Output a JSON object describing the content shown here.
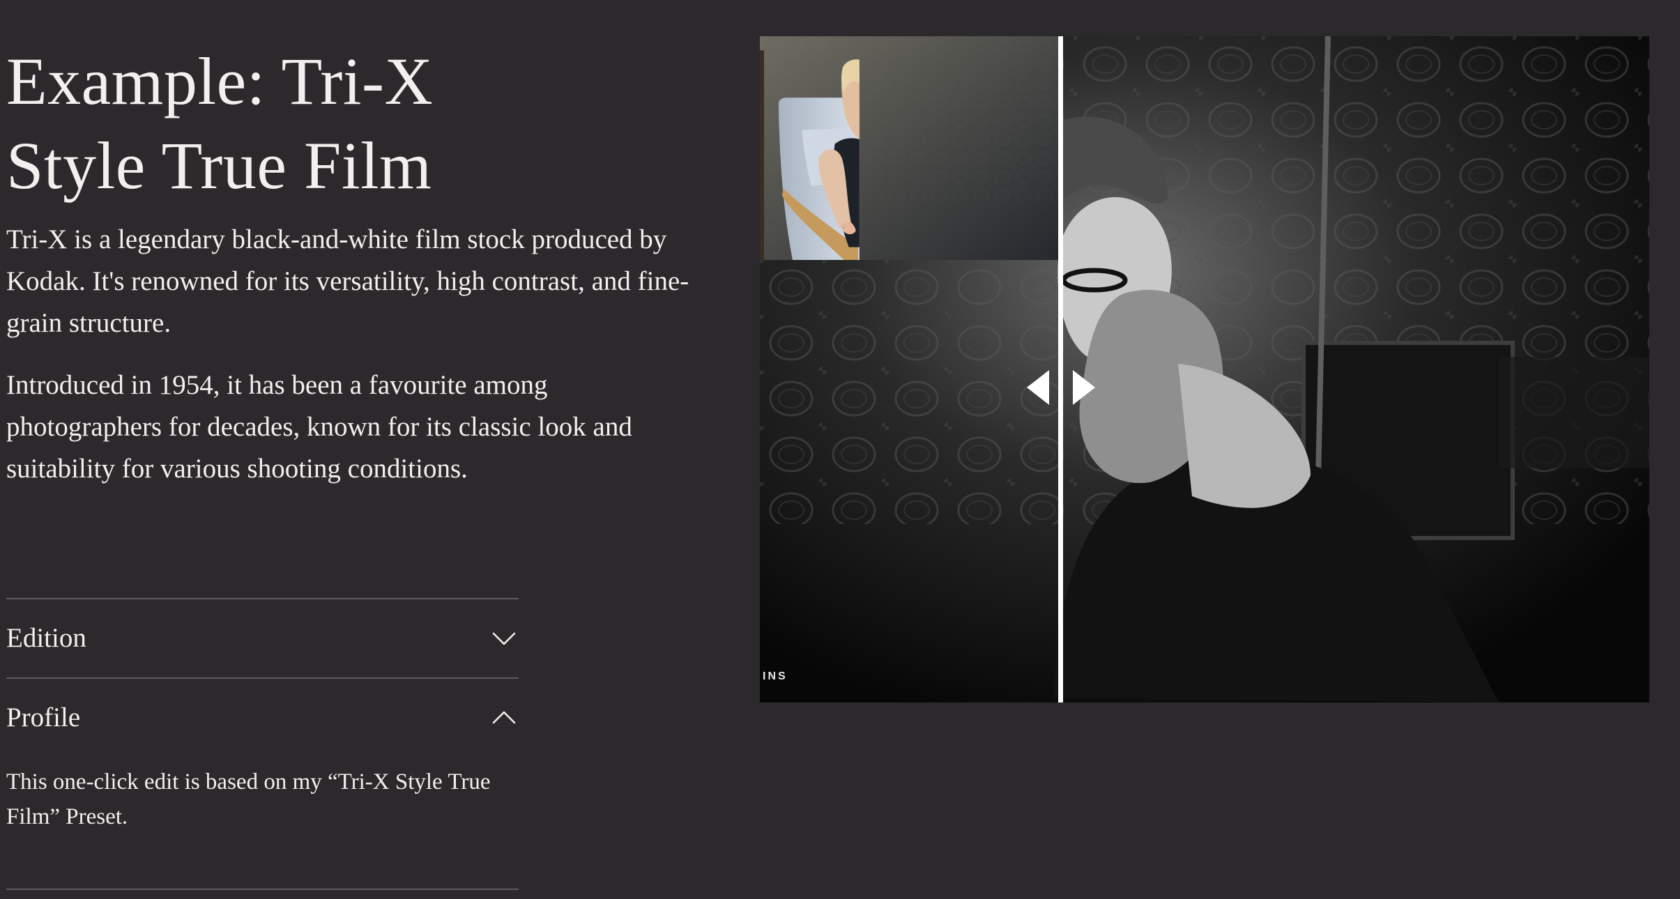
{
  "header": {
    "title_line_1": "Example: Tri-X",
    "title_line_2": "Style True Film"
  },
  "description": {
    "paragraph_1": "Tri-X is a legendary black-and-white film stock produced by Kodak. It's renowned for its versatility, high contrast, and fine-grain structure.",
    "paragraph_2": "Introduced in 1954, it has been a favourite among photographers for decades, known for its classic look and suitability for various shooting conditions."
  },
  "accordion": {
    "items": [
      {
        "label": "Edition",
        "expanded": false,
        "icon": "chevron-down-icon"
      },
      {
        "label": "Profile",
        "expanded": true,
        "icon": "chevron-up-icon",
        "body": "This one-click edit is based on my “Tri-X Style True Film” Preset."
      }
    ]
  },
  "comparison": {
    "before_label": "INS",
    "slider_position": 0.336,
    "handle_icon": "left-right-arrows-icon",
    "before_image": "mother-holding-baby-color",
    "after_image": "mother-holding-baby-black-and-white"
  },
  "colors": {
    "background": "#2b292b",
    "text": "#f2f0ee",
    "divider": "#5e5c5e",
    "slider": "#ffffff"
  }
}
